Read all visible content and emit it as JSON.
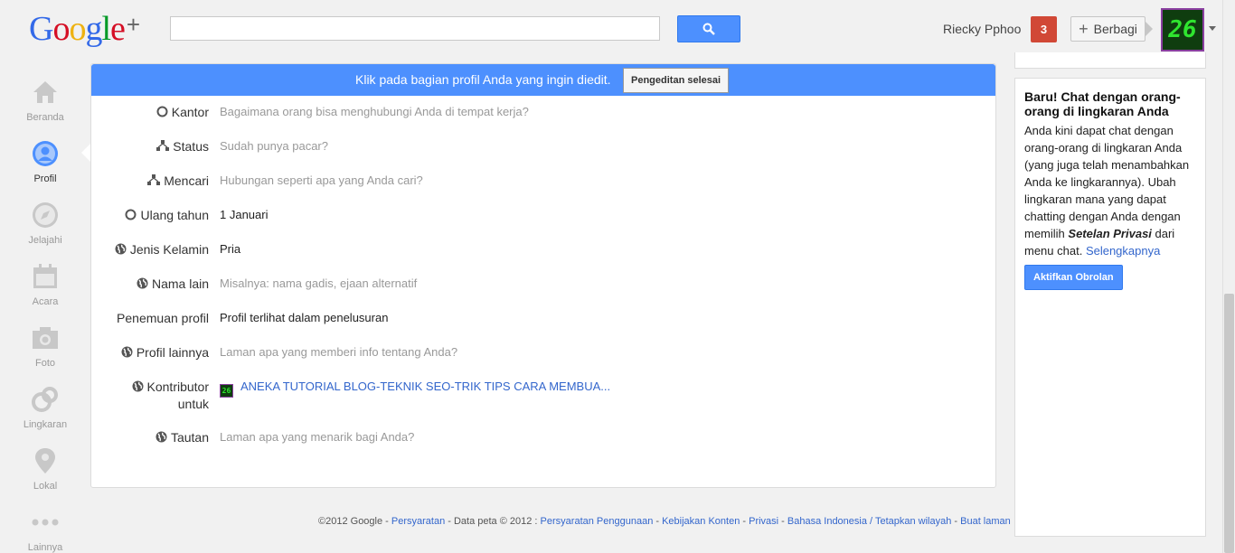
{
  "header": {
    "logo_letters": [
      {
        "ch": "G",
        "color": "#3369e8"
      },
      {
        "ch": "o",
        "color": "#d50f25"
      },
      {
        "ch": "o",
        "color": "#eeb211"
      },
      {
        "ch": "g",
        "color": "#3369e8"
      },
      {
        "ch": "l",
        "color": "#009925"
      },
      {
        "ch": "e",
        "color": "#d50f25"
      }
    ],
    "logo_plus": "+",
    "search_value": "",
    "user_name": "Riecky Pphoo",
    "notification_count": "3",
    "share_label": "Berbagi",
    "avatar_text": "26"
  },
  "nav": {
    "items": [
      {
        "label": "Beranda",
        "icon": "home-icon"
      },
      {
        "label": "Profil",
        "icon": "profile-icon",
        "active": true
      },
      {
        "label": "Jelajahi",
        "icon": "compass-icon"
      },
      {
        "label": "Acara",
        "icon": "calendar-icon"
      },
      {
        "label": "Foto",
        "icon": "camera-icon"
      },
      {
        "label": "Lingkaran",
        "icon": "circles-icon"
      },
      {
        "label": "Lokal",
        "icon": "location-icon"
      },
      {
        "label": "Lainnya",
        "icon": "more-icon"
      }
    ]
  },
  "banner": {
    "text": "Klik pada bagian profil Anda yang ingin diedit.",
    "done_label": "Pengeditan selesai"
  },
  "profile_rows": [
    {
      "label": "Kantor",
      "icon": "circle-icon",
      "value": "Bagaimana orang bisa menghubungi Anda di tempat kerja?",
      "style": "ph"
    },
    {
      "label": "Status",
      "icon": "network-icon",
      "value": "Sudah punya pacar?",
      "style": "ph"
    },
    {
      "label": "Mencari",
      "icon": "network-icon",
      "value": "Hubungan seperti apa yang Anda cari?",
      "style": "ph"
    },
    {
      "label": "Ulang tahun",
      "icon": "circle-icon",
      "value": "1 Januari",
      "style": "dark"
    },
    {
      "label": "Jenis Kelamin",
      "icon": "globe-icon",
      "value": "Pria",
      "style": "dark"
    },
    {
      "label": "Nama lain",
      "icon": "globe-icon",
      "value": "Misalnya: nama gadis, ejaan alternatif",
      "style": "ph"
    },
    {
      "label": "Penemuan profil",
      "icon": "",
      "value": "Profil terlihat dalam penelusuran",
      "style": "dark"
    },
    {
      "label": "Profil lainnya",
      "icon": "globe-icon",
      "value": "Laman apa yang memberi info tentang Anda?",
      "style": "ph"
    },
    {
      "label": "Kontributor",
      "label2": "untuk",
      "icon": "globe-icon",
      "value": "ANEKA TUTORIAL BLOG-TEKNIK SEO-TRIK TIPS CARA MEMBUA...",
      "style": "link",
      "thumb": "26"
    },
    {
      "label": "Tautan",
      "icon": "globe-icon",
      "value": "Laman apa yang menarik bagi Anda?",
      "style": "ph"
    }
  ],
  "footer": {
    "copyright": "©2012 Google - ",
    "terms": "Persyaratan",
    "map_data": " - Data peta © 2012 : ",
    "terms_of_use": "Persyaratan Penggunaan",
    "sep1": " - ",
    "content_policy": "Kebijakan Konten",
    "sep2": " - ",
    "privacy": "Privasi",
    "sep3": " - ",
    "language": "Bahasa Indonesia / Tetapkan wilayah",
    "sep4": " - ",
    "create_page": "Buat laman"
  },
  "chat_promo": {
    "title": "Baru! Chat dengan orang-orang di lingkaran Anda",
    "body_1": "Anda kini dapat chat dengan orang-orang di lingkaran Anda (yang juga telah menambahkan Anda ke lingkarannya). Ubah lingkaran mana yang dapat chatting dengan Anda dengan memilih ",
    "body_em": "Setelan Privasi",
    "body_2": " dari menu chat. ",
    "more_link": "Selengkapnya",
    "button": "Aktifkan Obrolan"
  }
}
